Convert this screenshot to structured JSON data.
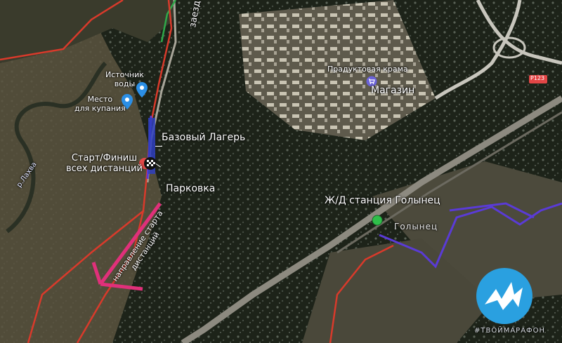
{
  "map": {
    "labels": {
      "access_road": "заезд",
      "water_source": "Источник\nводы",
      "swim_place": "Место\nдля купания",
      "base_camp": "Базовый Лагерь",
      "start_finish": "Старт/Финиш\nвсех дистанций",
      "parking": "Парковка",
      "river": "р.Лахва",
      "start_direction": "направление старта\nдистанций",
      "shop_poi": "Прадуктовая крама",
      "shop": "Магазин",
      "road_number": "Р123",
      "rail_station": "Ж/Д станция Голынец",
      "village": "Голынец"
    },
    "icons": {
      "water_pin": "location-pin-icon",
      "swim_pin": "location-pin-icon",
      "shop_icon": "shopping-cart-icon",
      "start_icon": "flag-checkered-icon",
      "station_icon": "green-dot-icon",
      "logo_icon": "mountain-m-logo-icon"
    },
    "colors": {
      "route_red": "#d93a2b",
      "route_purple": "#5a3bd6",
      "route_green": "#2fa84a",
      "arrow_magenta": "#e0307a",
      "pin_blue": "#2b8fe6",
      "station_green": "#2fbf4a",
      "logo_blue": "#2aa0e0"
    }
  },
  "logo": {
    "caption": "#ТВОЙМАРАФОН"
  }
}
